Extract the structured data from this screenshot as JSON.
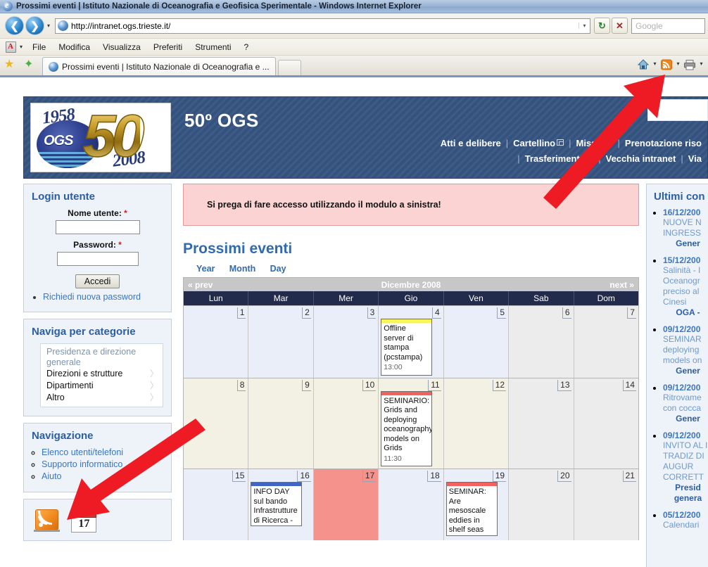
{
  "browser": {
    "window_title": "Prossimi eventi | Istituto Nazionale di Oceanografia e Geofisica Sperimentale - Windows Internet Explorer",
    "url": "http://intranet.ogs.trieste.it/",
    "search_placeholder": "Google",
    "menu": [
      "File",
      "Modifica",
      "Visualizza",
      "Preferiti",
      "Strumenti",
      "?"
    ],
    "tab_label": "Prossimi eventi | Istituto Nazionale di Oceanografia e ...",
    "back_glyph": "❮",
    "forward_glyph": "❯",
    "refresh_glyph": "↻",
    "stop_glyph": "✕",
    "caret_glyph": "▾"
  },
  "site": {
    "title": "50º OGS",
    "logo": {
      "year_from": "1958",
      "year_to": "2008",
      "mark": "OGS",
      "anniversary": "50"
    },
    "topnav_row1": [
      {
        "label": "Atti e delibere",
        "external": false
      },
      {
        "label": "Cartellino",
        "external": true
      },
      {
        "label": "Missioni",
        "external": false
      },
      {
        "label": "Prenotazione riso",
        "external": false
      }
    ],
    "topnav_row2": [
      {
        "label": "Trasferimento fi",
        "external": false
      },
      {
        "label": "Vecchia intranet",
        "external": false
      },
      {
        "label": "Via",
        "external": false
      }
    ]
  },
  "sidebar_left": {
    "login": {
      "heading": "Login utente",
      "username_label": "Nome utente:",
      "username_value": "",
      "password_label": "Password:",
      "password_value": "",
      "required_mark": "*",
      "submit_label": "Accedi",
      "links": [
        "Richiedi nuova password"
      ]
    },
    "categories": {
      "heading": "Naviga per categorie",
      "current": "Presidenza e direzione generale",
      "items": [
        "Direzioni e strutture",
        "Dipartimenti",
        "Altro"
      ],
      "arrow_glyph": "〉"
    },
    "navigation": {
      "heading": "Navigazione",
      "items": [
        "Elenco utenti/telefoni",
        "Supporto informatico",
        "Aiuto"
      ]
    },
    "feeds": {
      "rss_icon": "rss-feed-icon",
      "calendar_icon": "calendar-icon",
      "calendar_day": "17"
    }
  },
  "main": {
    "message": "Si prega di fare accesso utilizzando il modulo a sinistra!",
    "page_title": "Prossimi eventi",
    "view_tabs": [
      "Year",
      "Month",
      "Day"
    ],
    "calendar": {
      "prev_label": "« prev",
      "month_label": "Dicembre 2008",
      "next_label": "next »",
      "weekday_headers": [
        "Lun",
        "Mar",
        "Mer",
        "Gio",
        "Ven",
        "Sab",
        "Dom"
      ],
      "weeks": [
        [
          {
            "day": "1",
            "type": "weekday",
            "events": []
          },
          {
            "day": "2",
            "type": "weekday",
            "events": []
          },
          {
            "day": "3",
            "type": "weekday",
            "events": []
          },
          {
            "day": "4",
            "type": "weekday",
            "events": [
              {
                "title": "Offline server di stampa (pcstampa)",
                "time": "13:00",
                "stripe": "#fbf55a"
              }
            ]
          },
          {
            "day": "5",
            "type": "weekday",
            "events": []
          },
          {
            "day": "6",
            "type": "weekend",
            "events": []
          },
          {
            "day": "7",
            "type": "weekend",
            "events": []
          }
        ],
        [
          {
            "day": "8",
            "type": "past",
            "events": []
          },
          {
            "day": "9",
            "type": "past",
            "events": []
          },
          {
            "day": "10",
            "type": "past",
            "events": []
          },
          {
            "day": "11",
            "type": "past",
            "events": [
              {
                "title": "SEMINARIO: Grids and deploying oceanography models on Grids",
                "time": "11:30",
                "stripe": "#f4625f"
              }
            ]
          },
          {
            "day": "12",
            "type": "past",
            "events": []
          },
          {
            "day": "13",
            "type": "weekend",
            "events": []
          },
          {
            "day": "14",
            "type": "weekend",
            "events": []
          }
        ],
        [
          {
            "day": "15",
            "type": "weekday",
            "events": []
          },
          {
            "day": "16",
            "type": "weekday",
            "events": [
              {
                "title": "INFO DAY sul bando Infrastrutture di Ricerca -",
                "time": "",
                "stripe": "#3f66c4"
              }
            ]
          },
          {
            "day": "17",
            "type": "today",
            "events": []
          },
          {
            "day": "18",
            "type": "weekday",
            "events": []
          },
          {
            "day": "19",
            "type": "weekday",
            "events": [
              {
                "title": "SEMINAR: Are mesoscale eddies in shelf seas",
                "time": "",
                "stripe": "#f4625f"
              }
            ]
          },
          {
            "day": "20",
            "type": "weekend",
            "events": []
          },
          {
            "day": "21",
            "type": "weekend",
            "events": []
          }
        ]
      ]
    }
  },
  "sidebar_right": {
    "heading": "Ultimi con",
    "items": [
      {
        "date": "16/12/200",
        "title": "NUOVE N INGRESS",
        "category": "Gener"
      },
      {
        "date": "15/12/200",
        "title": "Salinità - I Oceanogr preciso al Cinesi",
        "category": "OGA -"
      },
      {
        "date": "09/12/200",
        "title": "SEMINAR deploying models on",
        "category": "Gener"
      },
      {
        "date": "09/12/200",
        "title": "Ritrovame con cocca",
        "category": "Gener"
      },
      {
        "date": "09/12/200",
        "title": "INVITO AL IL TRADIZ DI AUGUR CORRETT",
        "category": "Presid genera"
      },
      {
        "date": "05/12/200",
        "title": "Calendari",
        "category": ""
      }
    ]
  },
  "annotations": {
    "arrow_color": "#ee1b24",
    "arrows": [
      {
        "name": "arrow-to-rss-toolbar-button",
        "from": [
          765,
          287
        ],
        "to": [
          945,
          112
        ]
      },
      {
        "name": "arrow-to-feed-icons",
        "from": [
          293,
          612
        ],
        "to": [
          96,
          737
        ]
      }
    ]
  }
}
